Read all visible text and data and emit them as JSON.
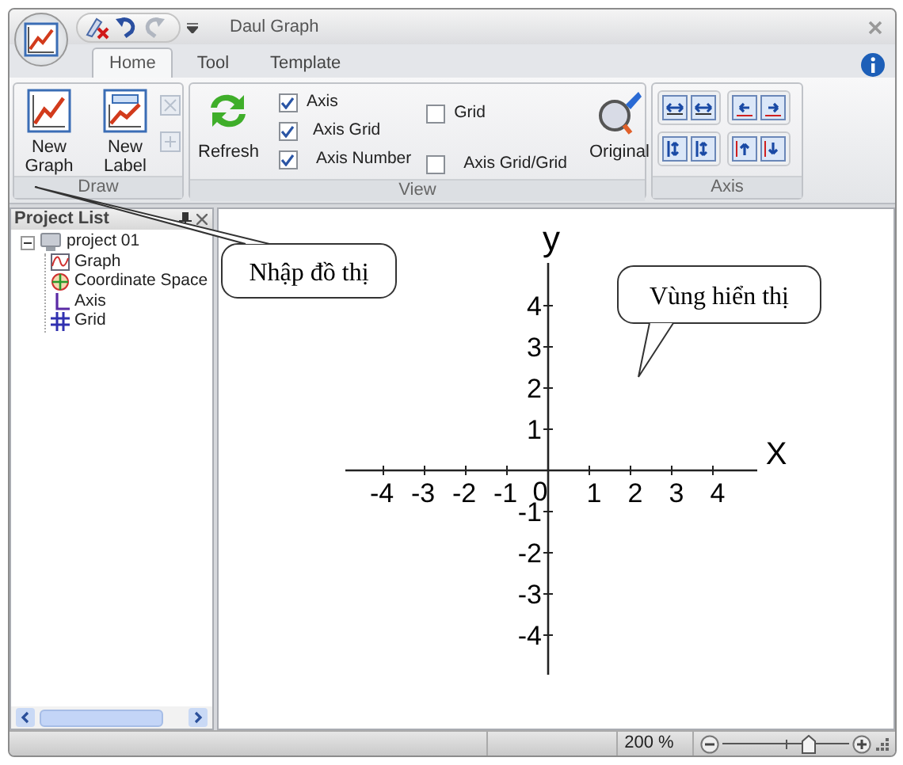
{
  "window": {
    "title": "Daul Graph"
  },
  "tabs": [
    {
      "label": "Home",
      "selected": true
    },
    {
      "label": "Tool",
      "selected": false
    },
    {
      "label": "Template",
      "selected": false
    }
  ],
  "ribbon": {
    "draw": {
      "label": "Draw",
      "buttons": [
        "New Graph",
        "New Label"
      ]
    },
    "view": {
      "label": "View",
      "refresh": "Refresh",
      "original": "Original",
      "checkboxes": [
        {
          "label": "Axis",
          "checked": true
        },
        {
          "label": "Axis Grid",
          "checked": true
        },
        {
          "label": "Axis Number",
          "checked": true
        },
        {
          "label": "Grid",
          "checked": false
        },
        {
          "label": "Axis Grid/Grid",
          "checked": false
        }
      ]
    },
    "axis": {
      "label": "Axis"
    }
  },
  "sidebar": {
    "title": "Project List",
    "tree": [
      {
        "label": "project 01",
        "expanded": true,
        "children": [
          {
            "label": "Graph",
            "kind": "graph"
          },
          {
            "label": "Coordinate Space",
            "kind": "coordinate"
          },
          {
            "label": "Axis",
            "kind": "axis"
          },
          {
            "label": "Grid",
            "kind": "grid"
          }
        ]
      }
    ]
  },
  "graph": {
    "x_label": "X",
    "y_label": "y",
    "origin_label": "0",
    "x_tick_labels": [
      "-4",
      "-3",
      "-2",
      "-1",
      "1",
      "2",
      "3",
      "4"
    ],
    "y_tick_labels": [
      "4",
      "3",
      "2",
      "1",
      "-1",
      "-2",
      "-3",
      "-4"
    ]
  },
  "callouts": [
    {
      "text": "Nhập đồ thị"
    },
    {
      "text": "Vùng hiển thị"
    }
  ],
  "status_bar": {
    "zoom": "200 %",
    "zoom_slider": {
      "level": 0.7
    }
  }
}
